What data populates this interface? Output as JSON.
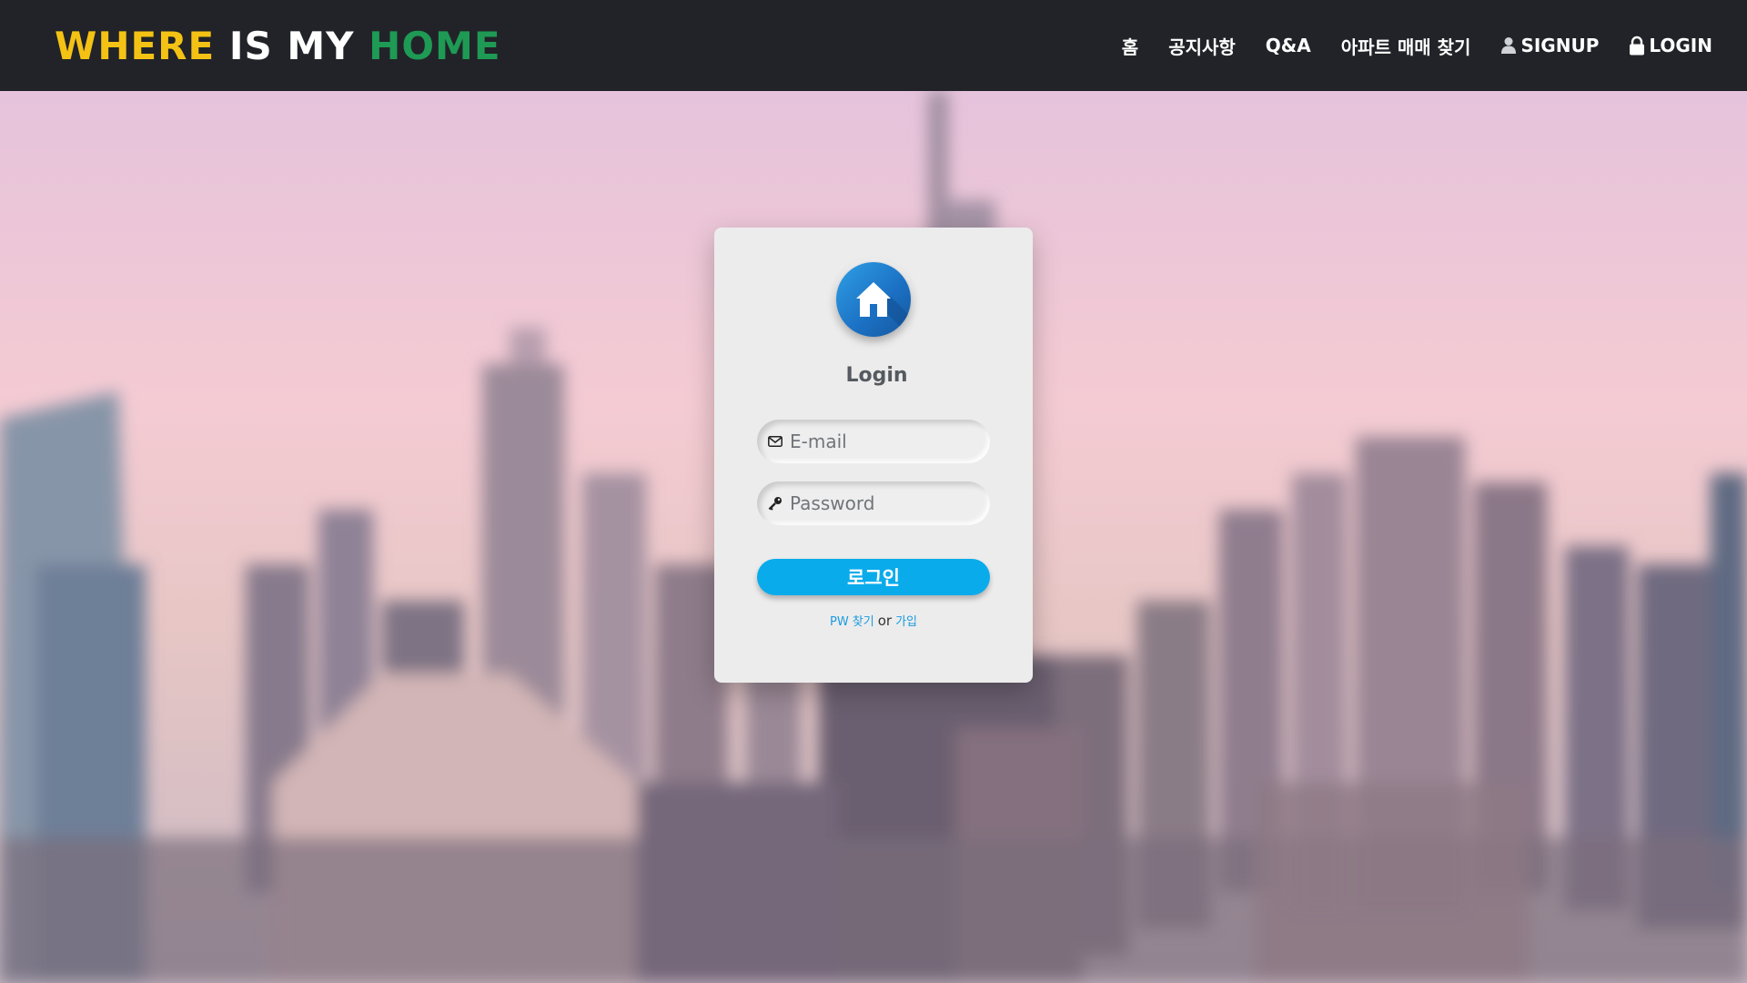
{
  "brand": {
    "word1": "WHERE",
    "word2": "IS MY",
    "word3": "HOME"
  },
  "nav": {
    "home": "홈",
    "notice": "공지사항",
    "qna": "Q&A",
    "apt_search": "아파트 매매 찾기",
    "signup": "SIGNUP",
    "login": "LOGIN"
  },
  "login_card": {
    "title": "Login",
    "email_placeholder": "E-mail",
    "password_placeholder": "Password",
    "submit_label": "로그인",
    "find_pw_link": "PW 찾기",
    "or_text": "or",
    "join_link": "가입"
  },
  "icons": {
    "logo": "house-icon",
    "signup": "user-icon",
    "login": "lock-icon",
    "email": "envelope-icon",
    "password": "key-icon"
  },
  "colors": {
    "navbar": "#212328",
    "brand_yellow": "#f4c214",
    "brand_white": "#ffffff",
    "brand_green": "#1e9a55",
    "button": "#0aabeb",
    "link": "#1a9be0",
    "logo_circle": "#1b6fc2"
  }
}
